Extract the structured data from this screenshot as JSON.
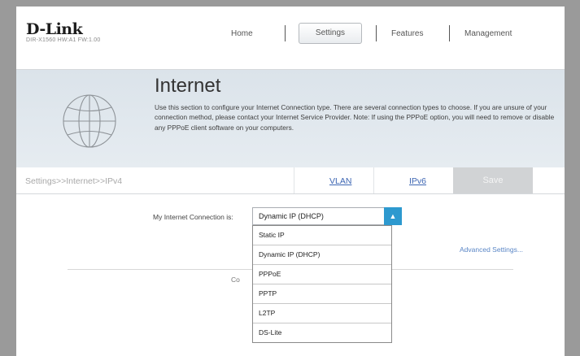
{
  "header": {
    "logo": "D-Link",
    "model": "DIR-X1560 HW:A1 FW:1.00",
    "nav": {
      "home": "Home",
      "settings": "Settings",
      "features": "Features",
      "management": "Management"
    }
  },
  "banner": {
    "title": "Internet",
    "description": "Use this section to configure your Internet Connection type. There are several connection types to choose. If you are unsure of your connection method, please contact your Internet Service Provider. Note: If using the PPPoE option, you will need to remove or disable any PPPoE client software on your computers."
  },
  "toolbar": {
    "breadcrumb": "Settings>>Internet>>IPv4",
    "vlan": "VLAN",
    "ipv6": "IPv6",
    "save": "Save"
  },
  "main": {
    "connection_label": "My Internet Connection is:",
    "selected": "Dynamic IP (DHCP)",
    "advanced": "Advanced Settings...",
    "partial_text": "Co",
    "options": [
      "Static IP",
      "Dynamic IP (DHCP)",
      "PPPoE",
      "PPTP",
      "L2TP",
      "DS-Lite"
    ]
  },
  "icons": {
    "globe": "globe-icon",
    "chevron": "chevron-up-icon"
  },
  "colors": {
    "accent": "#2d99cf",
    "link": "#3d66b3",
    "banner": "#dbe3ea",
    "save_disabled": "#d1d3d5"
  }
}
